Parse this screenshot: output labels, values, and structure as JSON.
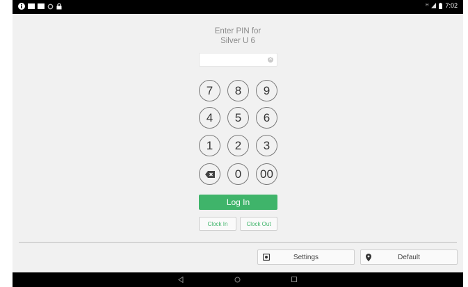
{
  "status_bar": {
    "left_icons": [
      "info-icon",
      "notification-icon",
      "notification-icon",
      "sync-icon",
      "lock-icon"
    ],
    "network_label": "H",
    "time": "7:02"
  },
  "login": {
    "prompt_line1": "Enter PIN for",
    "prompt_line2": "Silver U 6",
    "pin_value": "",
    "clear_icon": "clear-icon",
    "keys": [
      "7",
      "8",
      "9",
      "4",
      "5",
      "6",
      "1",
      "2",
      "3",
      "",
      "0",
      "00"
    ],
    "backspace_icon": "backspace-icon",
    "login_label": "Log In",
    "clock_in_label": "Clock In",
    "clock_out_label": "Clock Out"
  },
  "footer": {
    "settings_label": "Settings",
    "settings_icon": "settings-icon",
    "location_label": "Default",
    "location_icon": "location-pin-icon"
  },
  "navbar": {
    "icons": [
      "back-icon",
      "home-icon",
      "recents-icon"
    ]
  },
  "colors": {
    "accent": "#3fb46a",
    "background": "#f1f1f1",
    "statusbar": "#000000"
  }
}
